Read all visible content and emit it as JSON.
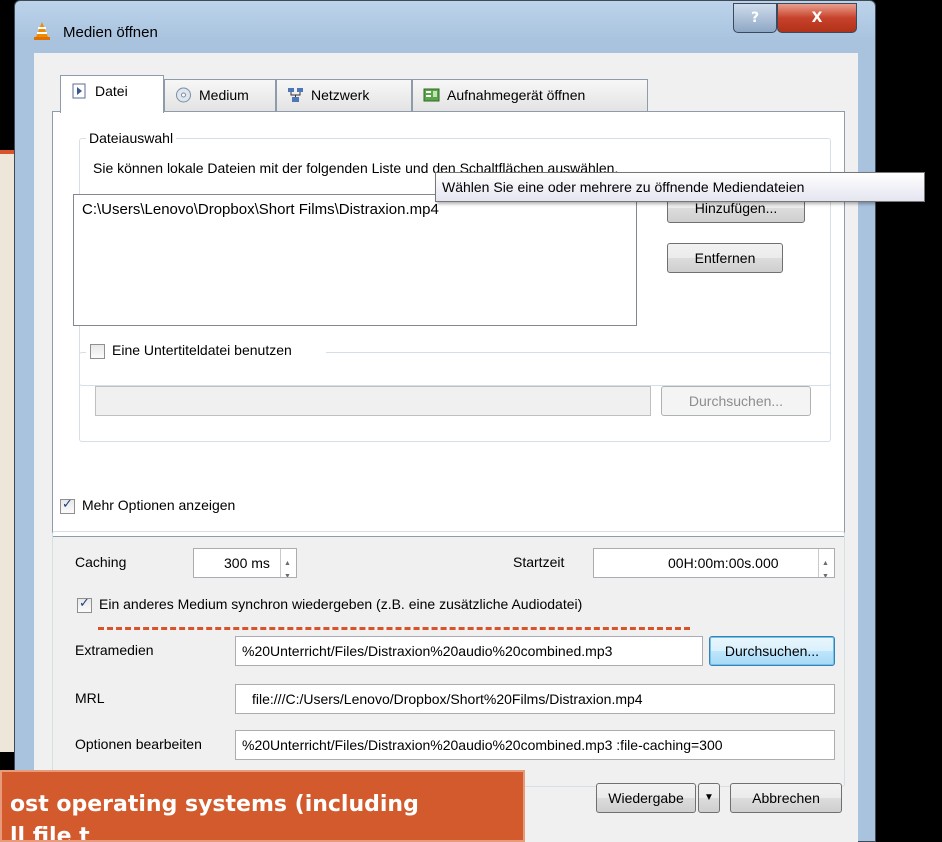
{
  "window": {
    "title": "Medien öffnen",
    "help_label": "?",
    "close_label": "X"
  },
  "tabs": [
    {
      "label": "Datei",
      "icon": "file-icon",
      "active": true
    },
    {
      "label": "Medium",
      "icon": "disc-icon",
      "active": false
    },
    {
      "label": "Netzwerk",
      "icon": "network-icon",
      "active": false
    },
    {
      "label": "Aufnahmegerät öffnen",
      "icon": "capture-device-icon",
      "active": false
    }
  ],
  "file_selection": {
    "group_label": "Dateiauswahl",
    "description": "Sie können lokale Dateien mit der folgenden Liste und den Schaltflächen auswählen.",
    "files": [
      "C:\\Users\\Lenovo\\Dropbox\\Short Films\\Distraxion.mp4"
    ],
    "add_label": "Hinzufügen...",
    "remove_label": "Entfernen",
    "tooltip": "Wählen Sie eine oder mehrere zu öffnende Mediendateien"
  },
  "subtitle": {
    "checkbox_label": "Eine Untertiteldatei benutzen",
    "checked": false,
    "path": "",
    "browse_label": "Durchsuchen..."
  },
  "more_options": {
    "checkbox_label": "Mehr Optionen anzeigen",
    "checked": true
  },
  "options": {
    "caching_label": "Caching",
    "caching_value": "300 ms",
    "start_label": "Startzeit",
    "start_value": "00H:00m:00s.000",
    "sync_label": "Ein anderes Medium synchron wiedergeben (z.B. eine zusätzliche Audiodatei)",
    "sync_checked": true,
    "extra_label": "Extramedien",
    "extra_value": "%20Unterricht/Files/Distraxion%20audio%20combined.mp3",
    "extra_browse_label": "Durchsuchen...",
    "mrl_label": "MRL",
    "mrl_value": "file:///C:/Users/Lenovo/Dropbox/Short%20Films/Distraxion.mp4",
    "edit_label": "Optionen bearbeiten",
    "edit_value": "%20Unterricht/Files/Distraxion%20audio%20combined.mp3 :file-caching=300"
  },
  "footer": {
    "play_label": "Wiedergabe",
    "cancel_label": "Abbrechen"
  },
  "callout": {
    "line1": "ost operating systems (including",
    "line2": "ll file t"
  },
  "colors": {
    "accent": "#d35a2c",
    "titlebar": "#a9c3df",
    "close": "#c7422b"
  }
}
